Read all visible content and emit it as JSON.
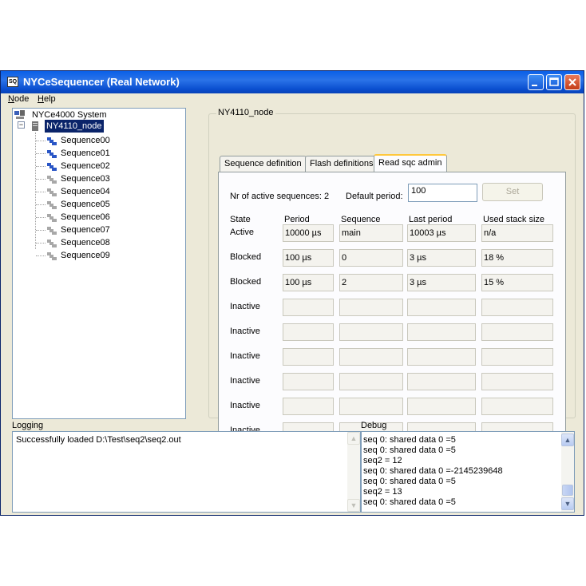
{
  "window": {
    "title": "NYCeSequencer (Real Network)",
    "icon_text": "SQ"
  },
  "menu": [
    {
      "label_ul": "N",
      "label_rest": "ode"
    },
    {
      "label_ul": "H",
      "label_rest": "elp"
    }
  ],
  "tree": {
    "root": "NYCe4000 System",
    "node": "NY4110_node",
    "expander": "−",
    "sequences": [
      {
        "label": "Sequence00",
        "active": true
      },
      {
        "label": "Sequence01",
        "active": true
      },
      {
        "label": "Sequence02",
        "active": true
      },
      {
        "label": "Sequence03",
        "active": false
      },
      {
        "label": "Sequence04",
        "active": false
      },
      {
        "label": "Sequence05",
        "active": false
      },
      {
        "label": "Sequence06",
        "active": false
      },
      {
        "label": "Sequence07",
        "active": false
      },
      {
        "label": "Sequence08",
        "active": false
      },
      {
        "label": "Sequence09",
        "active": false
      }
    ]
  },
  "group": {
    "legend": "NY4110_node"
  },
  "tabs": [
    {
      "label": "Sequence definition"
    },
    {
      "label": "Flash definitions"
    },
    {
      "label": "Read sqc admin"
    }
  ],
  "admin": {
    "active_label": "Nr of active sequences: 2",
    "default_period_label": "Default period:",
    "default_period_value": "100",
    "set_label": "Set",
    "headers": {
      "state": "State",
      "period": "Period",
      "sequence": "Sequence",
      "last_period": "Last period",
      "stack": "Used stack size"
    },
    "rows": [
      {
        "state": "Active",
        "period": "10000 µs",
        "sequence": "main",
        "last_period": "10003 µs",
        "stack": "n/a"
      },
      {
        "state": "Blocked",
        "period": "100 µs",
        "sequence": "0",
        "last_period": "3 µs",
        "stack": "18 %"
      },
      {
        "state": "Blocked",
        "period": "100 µs",
        "sequence": "2",
        "last_period": "3 µs",
        "stack": "15 %"
      },
      {
        "state": "Inactive",
        "period": "",
        "sequence": "",
        "last_period": "",
        "stack": ""
      },
      {
        "state": "Inactive",
        "period": "",
        "sequence": "",
        "last_period": "",
        "stack": ""
      },
      {
        "state": "Inactive",
        "period": "",
        "sequence": "",
        "last_period": "",
        "stack": ""
      },
      {
        "state": "Inactive",
        "period": "",
        "sequence": "",
        "last_period": "",
        "stack": ""
      },
      {
        "state": "Inactive",
        "period": "",
        "sequence": "",
        "last_period": "",
        "stack": ""
      },
      {
        "state": "Inactive",
        "period": "",
        "sequence": "",
        "last_period": "",
        "stack": ""
      }
    ]
  },
  "logging": {
    "label": "Logging",
    "lines": [
      "Successfully loaded D:\\Test\\seq2\\seq2.out"
    ]
  },
  "debug": {
    "label": "Debug",
    "lines": [
      "seq 0: shared data 0 =5",
      "seq 0: shared data 0 =5",
      "seq2 = 12",
      "seq 0: shared data 0 =-2145239648",
      "seq 0: shared data 0 =5",
      "seq2 = 13",
      "seq 0: shared data 0 =5"
    ]
  },
  "colors": {
    "title_bar": "#0a5fe8",
    "selection": "#0a246a",
    "window_bg": "#ece9d8",
    "active_tab_accent": "#ffc83c"
  }
}
